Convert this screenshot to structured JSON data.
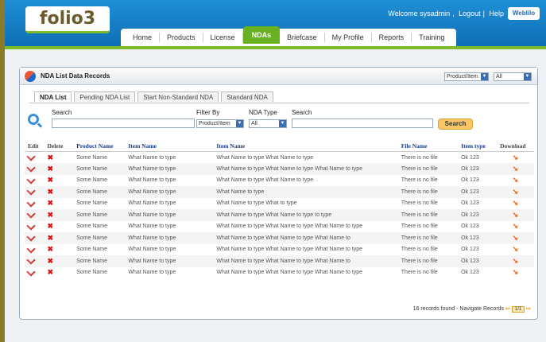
{
  "header": {
    "logo": "folio3",
    "welcome": "Welcome sysadmin",
    "logout": "Logout",
    "help": "Help",
    "brand": "Weblilo"
  },
  "nav": [
    "Home",
    "Products",
    "License",
    "NDAs",
    "Briefcase",
    "My Profile",
    "Reports",
    "Training"
  ],
  "panel": {
    "title": "NDA List Data Records",
    "top_select1": "Product/Item",
    "top_select2": "All"
  },
  "tabs": [
    "NDA List",
    "Pending NDA List",
    "Start Non-Standard NDA",
    "Standard NDA"
  ],
  "filters": {
    "search_label": "Search",
    "filter_label": "Filter By",
    "filter_value": "Product/Item",
    "type_label": "NDA Type",
    "type_value": "All",
    "search2_label": "Search",
    "button": "Search"
  },
  "columns": [
    "Edit",
    "Delete",
    "Product Name",
    "Item Name",
    "Item Name",
    "File Name",
    "Item type",
    "Download"
  ],
  "rows": [
    [
      "Some Name",
      "What Name to type",
      "What Name to type What Name to type",
      "There is no file",
      "Ok 123"
    ],
    [
      "Some Name",
      "What Name to type",
      "What Name to type What Name to type What Name to type",
      "There is no file",
      "Ok 123"
    ],
    [
      "Some Name",
      "What Name to type",
      "What Name to type What Name to type",
      "There is no file",
      "Ok 123"
    ],
    [
      "Some Name",
      "What Name to type",
      "What Name to type",
      "There is no file",
      "Ok 123"
    ],
    [
      "Some Name",
      "What Name to type",
      "What Name to type What  to type",
      "There is no file",
      "Ok 123"
    ],
    [
      "Some Name",
      "What Name to type",
      "What Name to type What Name to type to type",
      "There is no file",
      "Ok 123"
    ],
    [
      "Some Name",
      "What Name to type",
      "What Name to type What Name to type What Name to type",
      "There is no file",
      "Ok 123"
    ],
    [
      "Some Name",
      "What Name to type",
      "What Name to type What Name to type What Name to",
      "There is no file",
      "Ok 123"
    ],
    [
      "Some Name",
      "What Name to type",
      "What Name to type What Name to type What Name to type",
      "There is no file",
      "Ok 123"
    ],
    [
      "Some Name",
      "What Name to type",
      "What Name to type What Name to type What Name to",
      "There is no file",
      "Ok 123"
    ],
    [
      "Some Name",
      "What Name to type",
      "What Name to type What Name to type What Name to type",
      "There is no file",
      "Ok 123"
    ]
  ],
  "footer": {
    "found": "16 records found",
    "navigate": "Navigate Records",
    "page": "1/1"
  }
}
